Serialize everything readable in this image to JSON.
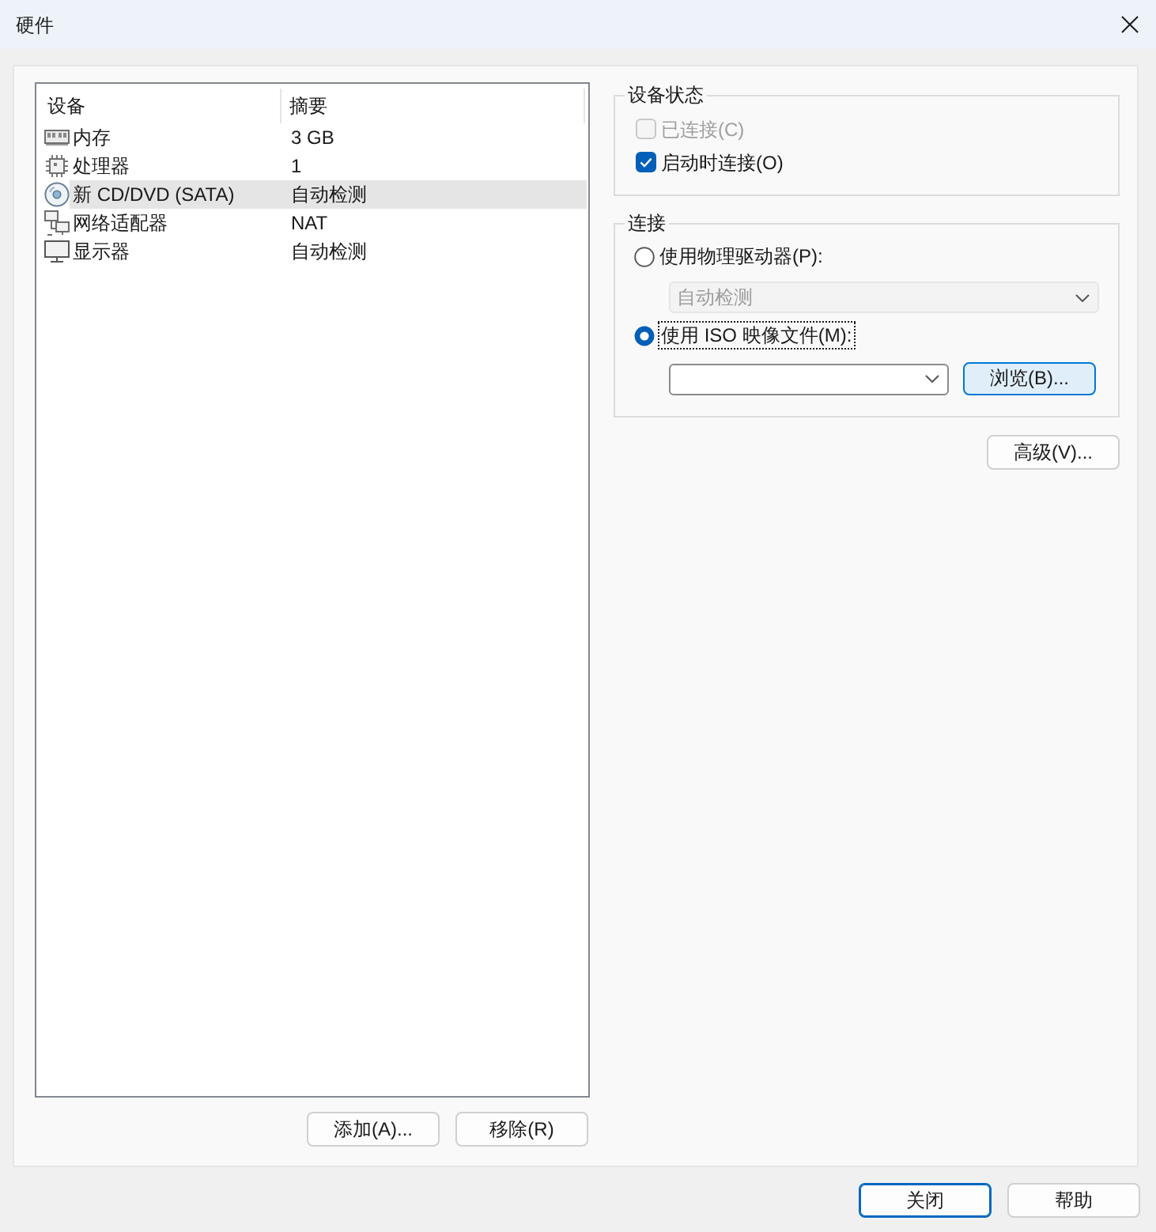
{
  "window": {
    "title": "硬件"
  },
  "device_list": {
    "columns": [
      "设备",
      "摘要"
    ],
    "rows": [
      {
        "kind": "memory",
        "device": "内存",
        "summary": "3 GB",
        "selected": false
      },
      {
        "kind": "processor",
        "device": "处理器",
        "summary": "1",
        "selected": false
      },
      {
        "kind": "cd_dvd",
        "device": "新 CD/DVD (SATA)",
        "summary": "自动检测",
        "selected": true
      },
      {
        "kind": "network",
        "device": "网络适配器",
        "summary": "NAT",
        "selected": false
      },
      {
        "kind": "display",
        "device": "显示器",
        "summary": "自动检测",
        "selected": false
      }
    ]
  },
  "list_buttons": [
    {
      "label": "添加(A)..."
    },
    {
      "label": "移除(R)"
    }
  ],
  "device_status": {
    "title": "设备状态",
    "options": [
      {
        "label": "已连接(C)",
        "checked": false,
        "disabled": true
      },
      {
        "label": "启动时连接(O)",
        "checked": true,
        "disabled": false
      }
    ]
  },
  "connection": {
    "title": "连接",
    "items": [
      {
        "kind": "radio",
        "label": "使用物理驱动器(P):",
        "selected": false,
        "focused": false
      },
      {
        "kind": "dropdown",
        "value": "自动检测",
        "disabled": true
      },
      {
        "kind": "radio",
        "label": "使用 ISO 映像文件(M):",
        "selected": true,
        "focused": true
      },
      {
        "kind": "file_picker",
        "button": "浏览(B)...",
        "hovered": true
      }
    ]
  },
  "advanced_button": {
    "label": "高级(V)..."
  },
  "footer_buttons": [
    {
      "label": "关闭",
      "default": true
    },
    {
      "label": "帮助",
      "default": false
    }
  ]
}
